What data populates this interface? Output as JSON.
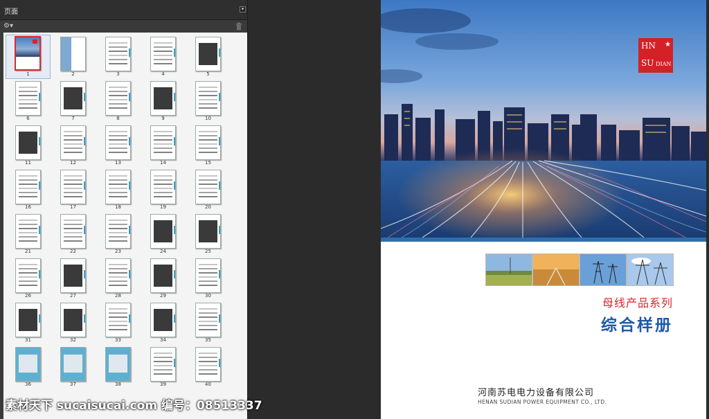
{
  "pages_panel": {
    "title": "页面",
    "menu_icon": "panel-menu-icon",
    "options_icon": "options-gear-icon",
    "delete_icon": "trash-icon",
    "thumbnails": [
      "1",
      "2",
      "3",
      "4",
      "5",
      "6",
      "7",
      "8",
      "9",
      "10",
      "11",
      "12",
      "13",
      "14",
      "15",
      "16",
      "17",
      "18",
      "19",
      "20",
      "21",
      "22",
      "23",
      "24",
      "25",
      "26",
      "27",
      "28",
      "29",
      "30",
      "31",
      "32",
      "33",
      "34",
      "35",
      "36",
      "37",
      "38",
      "39",
      "40"
    ],
    "selected_page": "1"
  },
  "document": {
    "logo": {
      "line1": "HN",
      "star": "★",
      "line2": "SU",
      "line3": "DIAN"
    },
    "series_title": "母线产品系列",
    "main_title": "综合样册",
    "company_cn": "河南苏电电力设备有限公司",
    "company_en": "HENAN SUDIAN POWER EQUIPMENT CO., LTD."
  },
  "watermark": "素材天下 sucaisucai.com  编号：08513337",
  "colors": {
    "accent_red": "#d42127",
    "accent_blue": "#1f5aa6",
    "panel_bg": "#3a3a3a",
    "workspace_bg": "#2b2b2b"
  }
}
